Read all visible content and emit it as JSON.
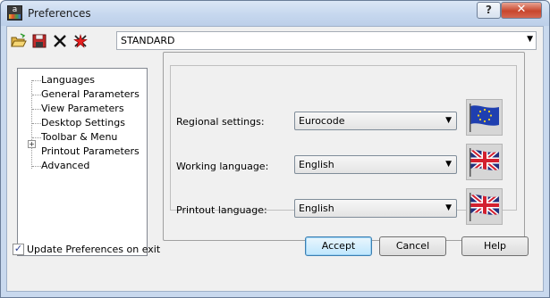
{
  "window": {
    "title": "Preferences",
    "help_glyph": "?",
    "close_glyph": "✕",
    "app_icon_letter": "a"
  },
  "toolbar": {
    "icons": [
      "open-folder-icon",
      "save-icon",
      "delete-icon",
      "new-star-icon"
    ],
    "profile_value": "STANDARD",
    "dropdown_glyph": "▼"
  },
  "tree": {
    "items": [
      {
        "label": "Languages",
        "selected": true
      },
      {
        "label": "General Parameters"
      },
      {
        "label": "View Parameters"
      },
      {
        "label": "Desktop Settings"
      },
      {
        "label": "Toolbar & Menu"
      },
      {
        "label": "Printout Parameters",
        "expandable": true
      },
      {
        "label": "Advanced"
      }
    ],
    "expander_glyph": "+"
  },
  "languages": {
    "rows": [
      {
        "label": "Regional settings:",
        "value": "Eurocode",
        "flag": "eu-flag-icon"
      },
      {
        "label": "Working language:",
        "value": "English",
        "flag": "uk-flag-icon"
      },
      {
        "label": "Printout language:",
        "value": "English",
        "flag": "uk-flag-icon"
      }
    ],
    "arrow_glyph": "▼"
  },
  "footer": {
    "update_label": "Update Preferences on exit",
    "update_checked": true,
    "check_glyph": "✓",
    "accept_label": "Accept",
    "cancel_label": "Cancel",
    "help_label": "Help"
  },
  "colors": {
    "titlebar": "#c6d7ee",
    "close_button": "#c8462d",
    "default_button_border": "#3c7fb1",
    "eu_blue": "#1f3fb0",
    "eu_star": "#f2d22a",
    "uk_blue": "#24307c",
    "uk_red": "#d3202f"
  }
}
